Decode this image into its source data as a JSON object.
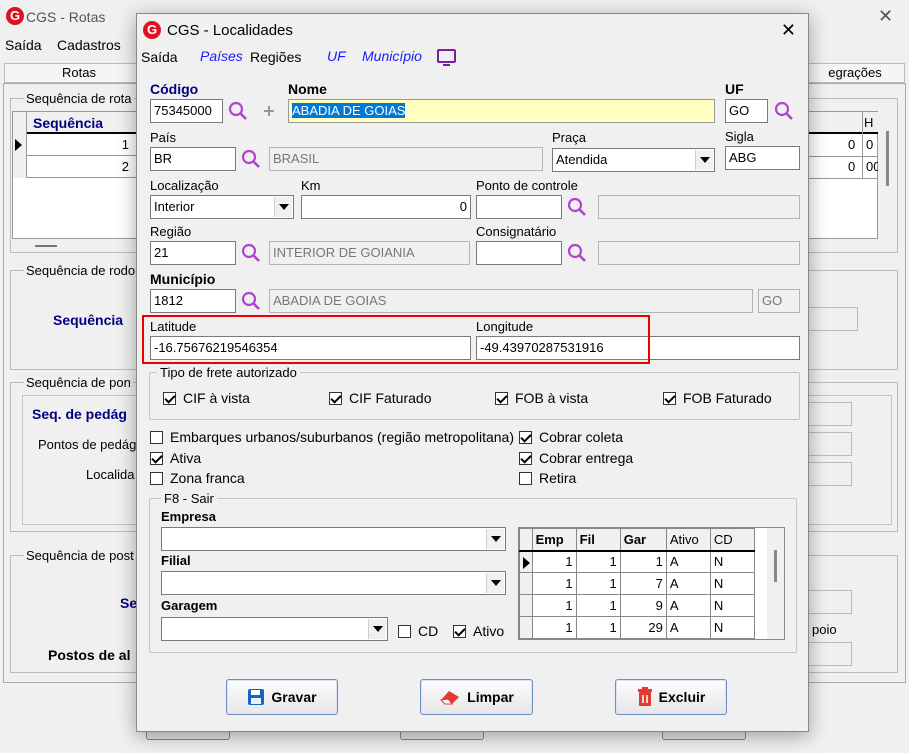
{
  "background": {
    "title": "CGS - Rotas",
    "menu": [
      "Saída",
      "Cadastros"
    ],
    "tabs": {
      "left": "Rotas",
      "right": "egrações"
    },
    "groups": {
      "rota": "Sequência de rota",
      "rodo": "Sequência de rodo",
      "pon": "Sequência de pon",
      "post": "Sequência de post"
    },
    "grid_header": "Sequência",
    "grid_rows": [
      "1",
      "2"
    ],
    "right_header": "H",
    "right_values": [
      [
        "0",
        "0"
      ],
      [
        "0",
        "00"
      ]
    ],
    "labels": {
      "sequencia": "Sequência",
      "seq_pedagio": "Seq. de pedág",
      "pontos_pedagio": "Pontos de pedág",
      "localidade": "Localida",
      "se": "Se",
      "postos": "Postos de al",
      "poio": "poio"
    }
  },
  "dialog": {
    "title": "CGS - Localidades",
    "menu": [
      {
        "label": "Saída",
        "style": "normal"
      },
      {
        "label": "Países",
        "style": "link"
      },
      {
        "label": "Regiões",
        "style": "normal"
      },
      {
        "label": "UF",
        "style": "link"
      },
      {
        "label": "Município",
        "style": "link"
      }
    ],
    "codigo": {
      "label": "Código",
      "value": "75345000"
    },
    "nome": {
      "label": "Nome",
      "value": "ABADIA DE GOIAS"
    },
    "uf": {
      "label": "UF",
      "value": "GO"
    },
    "pais": {
      "label": "País",
      "code": "BR",
      "name": "BRASIL"
    },
    "praca": {
      "label": "Praça",
      "value": "Atendida"
    },
    "sigla": {
      "label": "Sigla",
      "value": "ABG"
    },
    "localizacao": {
      "label": "Localização",
      "value": "Interior"
    },
    "km": {
      "label": "Km",
      "value": "0"
    },
    "ponto_controle": {
      "label": "Ponto de controle",
      "value": ""
    },
    "regiao": {
      "label": "Região",
      "code": "21",
      "name": "INTERIOR DE GOIANIA"
    },
    "consignatario": {
      "label": "Consignatário",
      "value": ""
    },
    "municipio": {
      "label": "Município",
      "code": "1812",
      "name": "ABADIA DE GOIAS",
      "uf": "GO"
    },
    "latitude": {
      "label": "Latitude",
      "value": "-16.75676219546354"
    },
    "longitude": {
      "label": "Longitude",
      "value": "-49.43970287531916"
    },
    "frete": {
      "label": "Tipo de frete autorizado",
      "options": [
        {
          "label": "CIF à vista",
          "checked": true
        },
        {
          "label": "CIF Faturado",
          "checked": true
        },
        {
          "label": "FOB à vista",
          "checked": true
        },
        {
          "label": "FOB Faturado",
          "checked": true
        }
      ]
    },
    "flags_left": [
      {
        "label": "Embarques urbanos/suburbanos (região metropolitana)",
        "checked": false
      },
      {
        "label": "Ativa",
        "checked": true
      },
      {
        "label": "Zona franca",
        "checked": false
      }
    ],
    "flags_right": [
      {
        "label": "Cobrar coleta",
        "checked": true
      },
      {
        "label": "Cobrar entrega",
        "checked": true
      },
      {
        "label": "Retira",
        "checked": false
      }
    ],
    "f8": {
      "label": "F8 - Sair",
      "empresa": {
        "label": "Empresa",
        "value": ""
      },
      "filial": {
        "label": "Filial",
        "value": ""
      },
      "garagem": {
        "label": "Garagem",
        "value": ""
      },
      "cd": {
        "label": "CD",
        "checked": false
      },
      "ativo": {
        "label": "Ativo",
        "checked": true
      },
      "columns": [
        "Emp",
        "Fil",
        "Gar",
        "Ativo",
        "CD"
      ],
      "rows": [
        [
          "1",
          "1",
          "1",
          "A",
          "N"
        ],
        [
          "1",
          "1",
          "7",
          "A",
          "N"
        ],
        [
          "1",
          "1",
          "9",
          "A",
          "N"
        ],
        [
          "1",
          "1",
          "29",
          "A",
          "N"
        ]
      ]
    },
    "buttons": {
      "gravar": "Gravar",
      "limpar": "Limpar",
      "excluir": "Excluir"
    },
    "colors": {
      "highlight": "#e00000",
      "link": "#1a1aff",
      "selection": "#0078d7",
      "name_field": "#ffffc0"
    }
  }
}
